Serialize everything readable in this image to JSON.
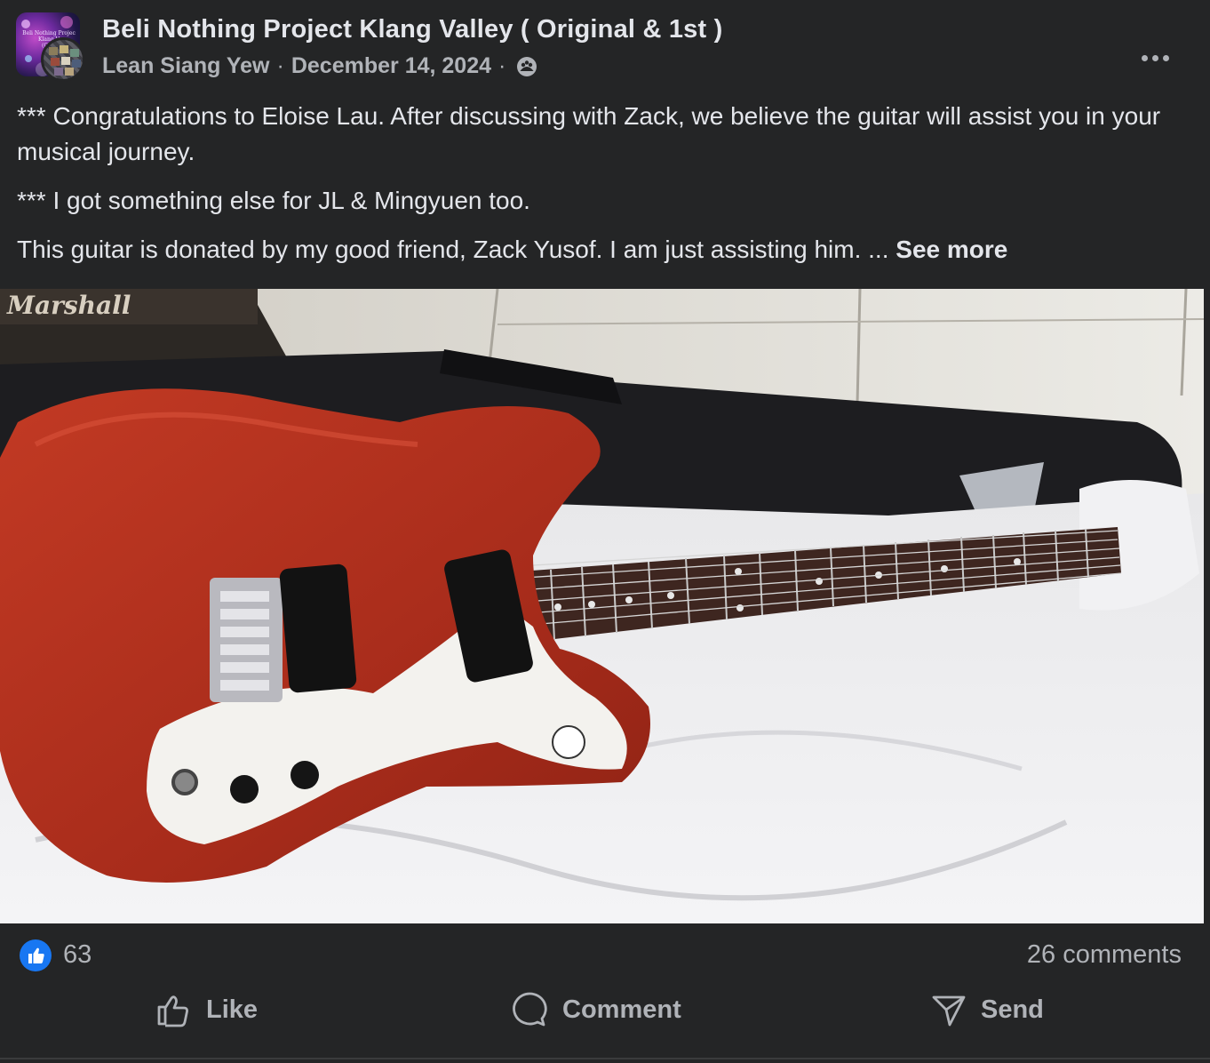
{
  "post": {
    "group_name": "Beli Nothing Project Klang Valley ( Original & 1st )",
    "author": "Lean Siang Yew",
    "date": "December 14, 2024",
    "separator": "·",
    "privacy_icon": "group-members-icon",
    "more_icon": "more-options-icon",
    "avatar_text": [
      "Beli Nothing Projec",
      "Klang V",
      "(Orig"
    ],
    "paragraphs": [
      "*** Congratulations to Eloise Lau. After discussing with Zack, we believe the guitar will assist you in your musical journey.",
      "*** I got something else for JL & Mingyuen too.",
      "This guitar is donated by my good friend, Zack Yusof. I am just assisting him. ... "
    ],
    "see_more": "See more",
    "photo": {
      "subject": "red-electric-guitar-on-case",
      "amp_brand_text": "Marshall"
    }
  },
  "engagement": {
    "reaction_icon": "like-thumb-icon",
    "reaction_count": "63",
    "comments": "26 comments"
  },
  "actions": {
    "like": "Like",
    "comment": "Comment",
    "send": "Send"
  },
  "colors": {
    "background": "#242526",
    "primary_text": "#e4e6eb",
    "secondary_text": "#b0b3b8",
    "like_blue": "#1877f2",
    "guitar_red": "#b8321f"
  }
}
